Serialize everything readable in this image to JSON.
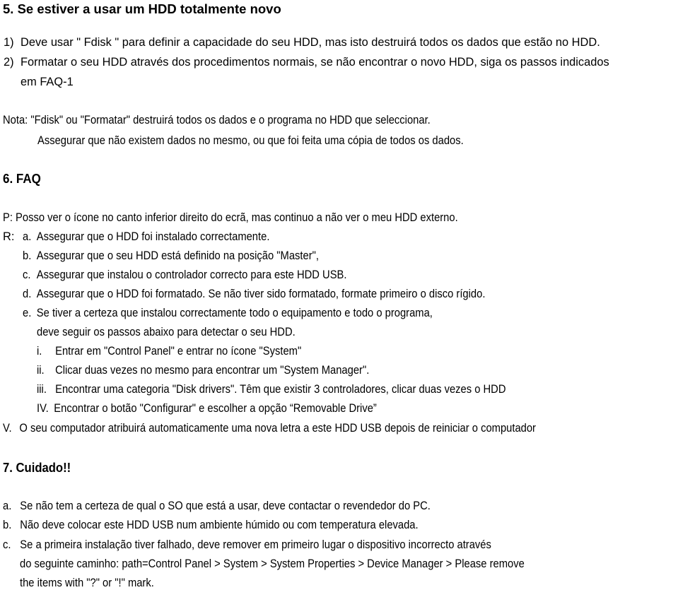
{
  "section5": {
    "heading": "5. Se estiver a usar um HDD totalmente novo",
    "items": [
      {
        "marker": "1)",
        "text": "Deve usar \" Fdisk \" para definir a capacidade do seu HDD, mas isto destruirá todos os dados que estão no HDD."
      },
      {
        "marker": "2)",
        "text": "Formatar o seu HDD através dos procedimentos normais, se não encontrar o novo HDD, siga os passos indicados",
        "continuation": "em FAQ-1"
      }
    ],
    "note": {
      "label": "Nota:",
      "line1": "\"Fdisk\" ou \"Formatar\" destruirá todos os dados e o programa no HDD que seleccionar.",
      "line2": "Assegurar que não existem dados no mesmo, ou que foi feita uma cópia de todos os dados."
    }
  },
  "section6": {
    "heading": "6. FAQ",
    "question": {
      "label": "P:",
      "text": "Posso ver o ícone no canto inferior direito do ecrã, mas continuo a não ver o meu HDD externo."
    },
    "answer_label": "R:",
    "answers": [
      {
        "marker": "a.",
        "text": "Assegurar que o HDD foi instalado correctamente."
      },
      {
        "marker": "b.",
        "text": "Assegurar que o seu HDD está definido na posição \"Master\","
      },
      {
        "marker": "c.",
        "text": "Assegurar que instalou o controlador correcto para este HDD USB."
      },
      {
        "marker": "d.",
        "text": "Assegurar que o HDD foi formatado. Se não tiver sido formatado, formate primeiro o disco rígido."
      },
      {
        "marker": "e.",
        "text": "Se tiver a certeza que instalou correctamente todo o equipamento e todo o programa,",
        "continuation": "deve seguir os passos abaixo para detectar o seu HDD."
      }
    ],
    "steps": [
      {
        "marker": "i.",
        "text": "Entrar em \"Control Panel\" e entrar no ícone \"System\""
      },
      {
        "marker": "ii.",
        "text": "Clicar duas vezes no mesmo para encontrar um \"System Manager\"."
      },
      {
        "marker": "iii.",
        "text": "Encontrar uma categoria \"Disk drivers\". Têm que existir 3 controladores, clicar duas vezes o HDD"
      },
      {
        "marker": "IV.",
        "text": "Encontrar o botão \"Configurar\" e escolher a opção “Removable Drive”"
      }
    ],
    "final": {
      "marker": "V.",
      "text": "O seu computador atribuirá automaticamente uma nova letra a este HDD USB depois de reiniciar o computador"
    }
  },
  "section7": {
    "heading": "7. Cuidado!!",
    "items": [
      {
        "marker": "a.",
        "text": "Se não tem a certeza de qual o SO que está a usar, deve contactar o revendedor do PC."
      },
      {
        "marker": "b.",
        "text": "Não deve colocar este HDD USB num ambiente húmido ou com temperatura elevada."
      },
      {
        "marker": "c.",
        "text": "Se a primeira instalação tiver falhado, deve remover em primeiro lugar o dispositivo incorrecto através",
        "continuation1": "do seguinte caminho: path=Control Panel > System > System Properties > Device Manager > Please remove",
        "continuation2": "the items with \"?\" or \"!\" mark."
      }
    ]
  }
}
